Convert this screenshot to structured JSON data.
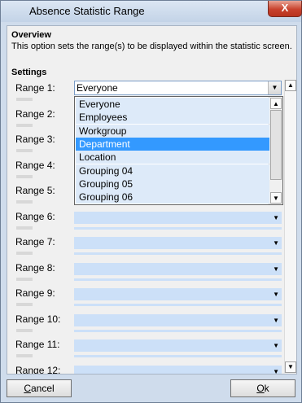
{
  "window": {
    "title": "Absence Statistic Range",
    "close_glyph": "X"
  },
  "overview": {
    "heading": "Overview",
    "description": "This option sets the range(s) to be displayed within the statistic screen."
  },
  "settings": {
    "heading": "Settings",
    "ranges": [
      {
        "label": "Range 1:",
        "value": "Everyone"
      },
      {
        "label": "Range 2:",
        "value": ""
      },
      {
        "label": "Range 3:",
        "value": ""
      },
      {
        "label": "Range 4:",
        "value": ""
      },
      {
        "label": "Range 5:",
        "value": ""
      },
      {
        "label": "Range 6:",
        "value": ""
      },
      {
        "label": "Range 7:",
        "value": ""
      },
      {
        "label": "Range 8:",
        "value": ""
      },
      {
        "label": "Range 9:",
        "value": ""
      },
      {
        "label": "Range 10:",
        "value": ""
      },
      {
        "label": "Range 11:",
        "value": ""
      },
      {
        "label": "Range 12:",
        "value": ""
      }
    ]
  },
  "dropdown": {
    "selected": "Department",
    "options": [
      "Everyone",
      "Employees",
      "Workgroup",
      "Department",
      "Location",
      "Grouping 04",
      "Grouping 05",
      "Grouping 06"
    ]
  },
  "footer": {
    "cancel_label": "Cancel",
    "ok_label": "Ok",
    "cancel_key": "C",
    "ok_key": "O"
  },
  "icons": {
    "dropdown_arrow": "chevron-down-icon",
    "scroll_up": "chevron-up-icon"
  }
}
